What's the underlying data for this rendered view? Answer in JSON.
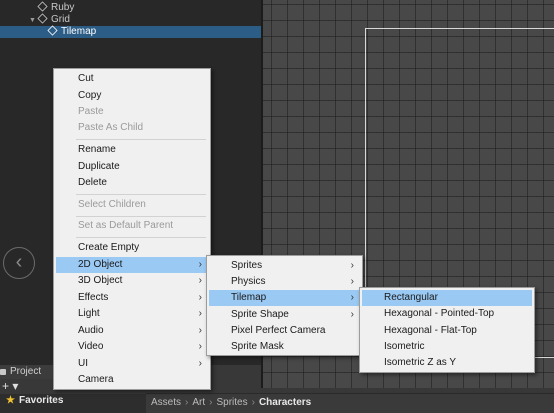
{
  "hierarchy": {
    "items": [
      {
        "label": "Ruby"
      },
      {
        "label": "Grid"
      },
      {
        "label": "Tilemap"
      }
    ]
  },
  "nav": {
    "left_glyph": "‹"
  },
  "bottom": {
    "project_tab": "Project",
    "add_label": "+ ▾",
    "favorites": "Favorites",
    "breadcrumb": [
      "Assets",
      "Art",
      "Sprites",
      "Characters"
    ]
  },
  "context_menu": {
    "items": [
      "Cut",
      "Copy",
      "Paste",
      "Paste As Child",
      "Rename",
      "Duplicate",
      "Delete",
      "Select Children",
      "Set as Default Parent",
      "Create Empty",
      "2D Object",
      "3D Object",
      "Effects",
      "Light",
      "Audio",
      "Video",
      "UI",
      "Camera"
    ]
  },
  "submenu_2d": {
    "items": [
      "Sprites",
      "Physics",
      "Tilemap",
      "Sprite Shape",
      "Pixel Perfect Camera",
      "Sprite Mask"
    ]
  },
  "submenu_tilemap": {
    "items": [
      "Rectangular",
      "Hexagonal - Pointed-Top",
      "Hexagonal - Flat-Top",
      "Isometric",
      "Isometric Z as Y"
    ]
  },
  "colors": {
    "selection": "#2c5d87",
    "menu_highlight": "#9ac9f3",
    "menu_bg": "#f0f0f0"
  }
}
